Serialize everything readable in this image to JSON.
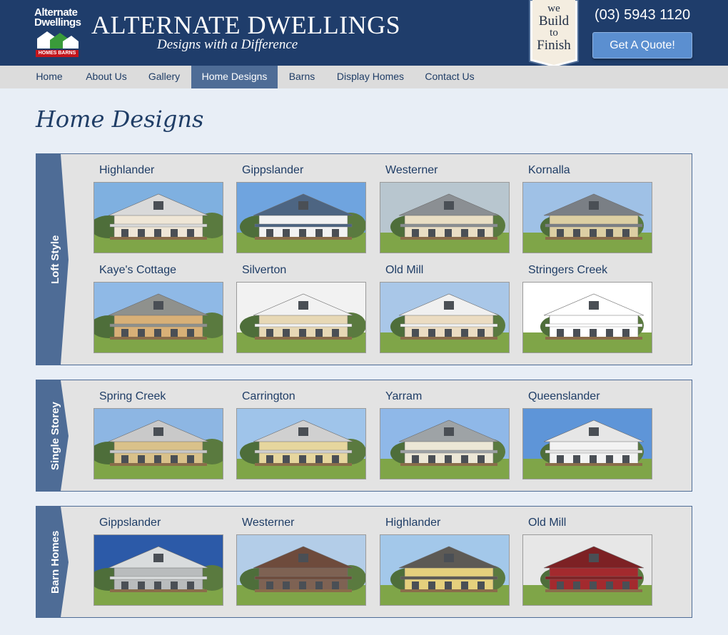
{
  "header": {
    "logo_line1": "Alternate",
    "logo_line2": "Dwellings",
    "logo_tag": "HOMES BARNS",
    "brand": "ALTERNATE DWELLINGS",
    "tagline": "Designs with a Difference",
    "badge": [
      "we",
      "Build",
      "to",
      "Finish"
    ],
    "phone": "(03) 5943 1120",
    "quote_label": "Get A Quote!"
  },
  "nav": [
    {
      "label": "Home"
    },
    {
      "label": "About Us"
    },
    {
      "label": "Gallery"
    },
    {
      "label": "Home Designs",
      "active": true
    },
    {
      "label": "Barns"
    },
    {
      "label": "Display Homes"
    },
    {
      "label": "Contact Us"
    }
  ],
  "page_title": "Home Designs",
  "sections": [
    {
      "label": "Loft Style",
      "items": [
        {
          "title": "Highlander",
          "wall": "#efe6d6",
          "roof": "#d9d9d9",
          "sky": "#7fb0e0"
        },
        {
          "title": "Gippslander",
          "wall": "#f2f2f2",
          "roof": "#4d6582",
          "sky": "#6fa4df"
        },
        {
          "title": "Westerner",
          "wall": "#e9dec4",
          "roof": "#8b8f93",
          "sky": "#b8c6cf"
        },
        {
          "title": "Kornalla",
          "wall": "#dccfa3",
          "roof": "#7a7f85",
          "sky": "#9fc1e6"
        },
        {
          "title": "Kaye's Cottage",
          "wall": "#d8b077",
          "roof": "#8f918d",
          "sky": "#8fb9e6"
        },
        {
          "title": "Silverton",
          "wall": "#e7d8b5",
          "roof": "#f2f2f2",
          "sky": "#f2f2f2"
        },
        {
          "title": "Old Mill",
          "wall": "#ebdcc2",
          "roof": "#f0f0f0",
          "sky": "#a9c7e8"
        },
        {
          "title": "Stringers Creek",
          "wall": "#ffffff",
          "roof": "#ffffff",
          "sky": "#ffffff"
        }
      ]
    },
    {
      "label": "Single Storey",
      "items": [
        {
          "title": "Spring Creek",
          "wall": "#d9c18a",
          "roof": "#c9c9c9",
          "sky": "#8db6e3"
        },
        {
          "title": "Carrington",
          "wall": "#e6d69e",
          "roof": "#d0d0d0",
          "sky": "#9fc4ea"
        },
        {
          "title": "Yarram",
          "wall": "#ece7d6",
          "roof": "#9ea3a6",
          "sky": "#8fb8e8"
        },
        {
          "title": "Queenslander",
          "wall": "#f3f3f3",
          "roof": "#e6e6e6",
          "sky": "#5e95d8"
        }
      ]
    },
    {
      "label": "Barn Homes",
      "items": [
        {
          "title": "Gippslander",
          "wall": "#b9bcbd",
          "roof": "#d9dcdd",
          "sky": "#2c5aa8"
        },
        {
          "title": "Westerner",
          "wall": "#7e6253",
          "roof": "#6e4b3c",
          "sky": "#b3cde8"
        },
        {
          "title": "Highlander",
          "wall": "#e5d07d",
          "roof": "#5d5a55",
          "sky": "#a3c8ea"
        },
        {
          "title": "Old Mill",
          "wall": "#a32a2e",
          "roof": "#7d2124",
          "sky": "#e7e7e7"
        }
      ]
    }
  ]
}
